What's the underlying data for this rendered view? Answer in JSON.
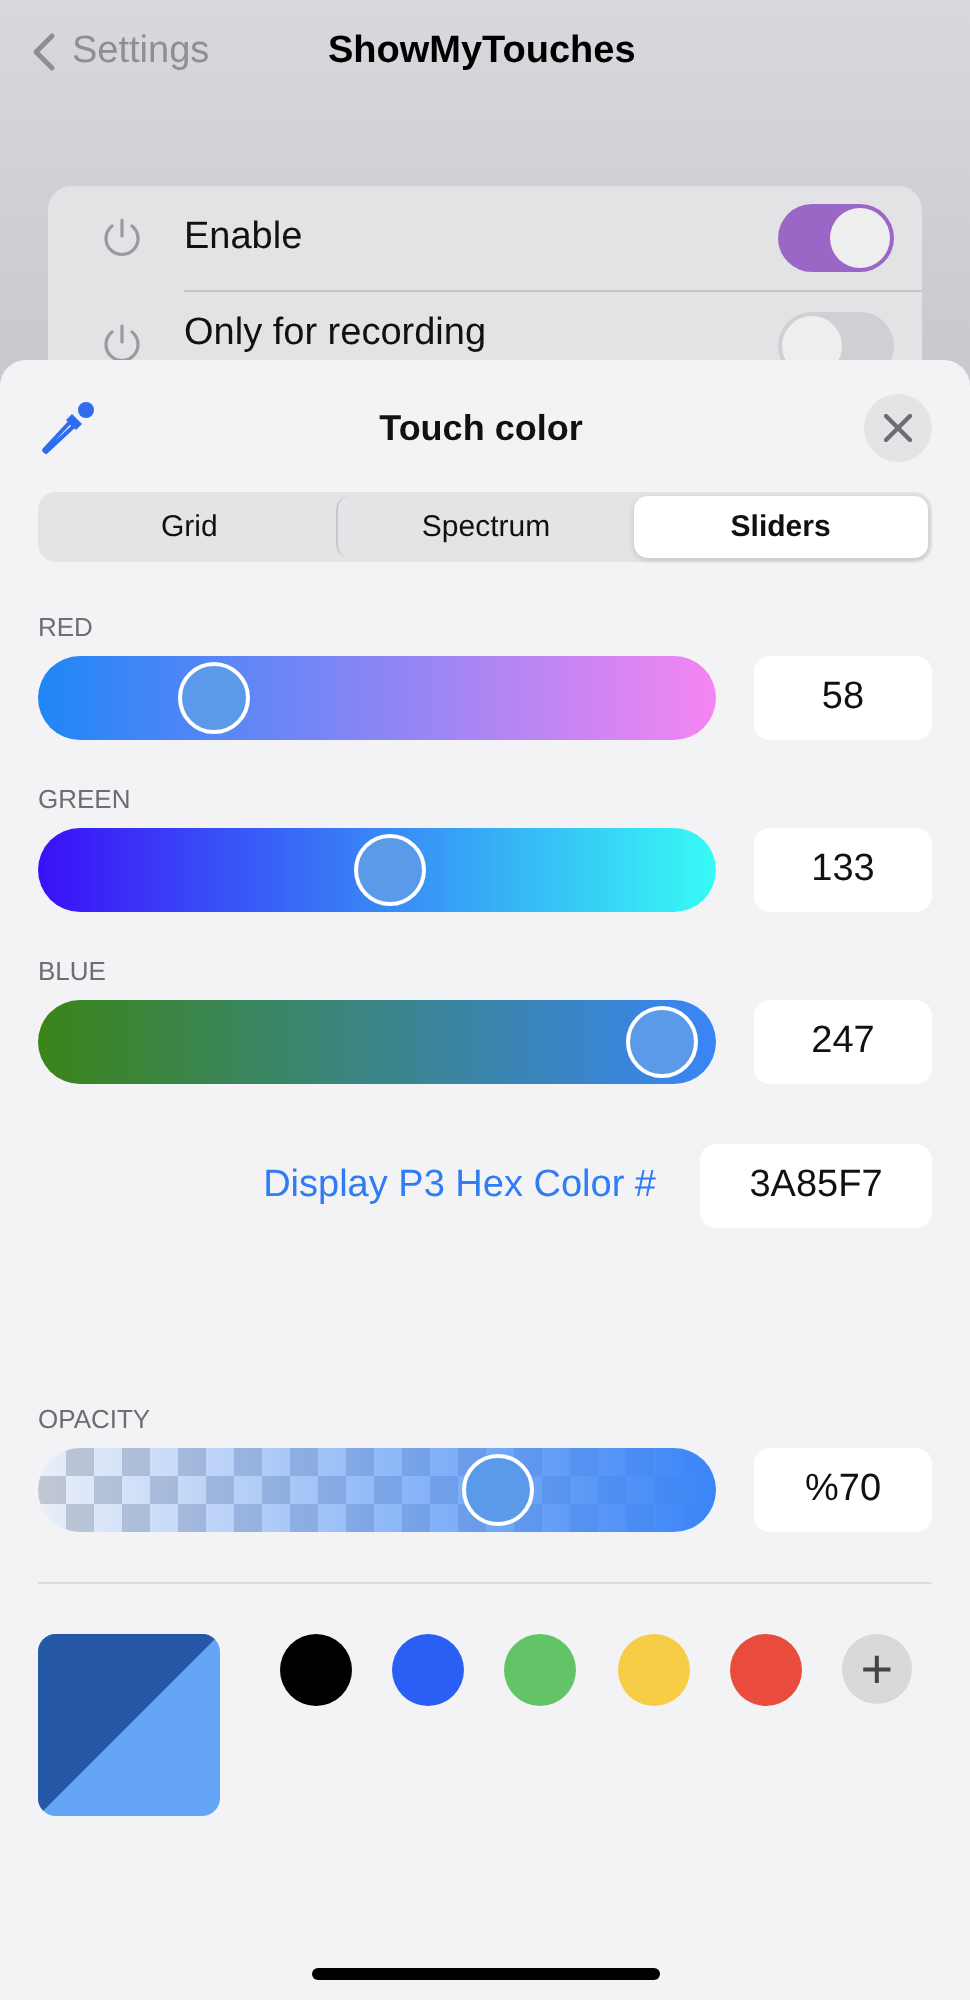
{
  "nav": {
    "back": "Settings",
    "title": "ShowMyTouches"
  },
  "settings": [
    {
      "label": "Enable",
      "on": true
    },
    {
      "label": "Only for recording",
      "on": false
    }
  ],
  "sheet": {
    "title": "Touch color",
    "tabs": [
      {
        "label": "Grid",
        "selected": false
      },
      {
        "label": "Spectrum",
        "selected": false
      },
      {
        "label": "Sliders",
        "selected": true
      }
    ],
    "sliders": [
      {
        "kind": "red",
        "label": "RED",
        "level": 0.23,
        "value": "58"
      },
      {
        "kind": "green",
        "label": "GREEN",
        "level": 0.52,
        "value": "133"
      },
      {
        "kind": "blue",
        "label": "BLUE",
        "level": 0.97,
        "value": "247"
      }
    ],
    "hex": {
      "label": "Display P3 Hex Color #",
      "value": "3A85F7"
    },
    "opacity": {
      "label": "OPACITY",
      "level": 0.7,
      "value": "%70"
    },
    "swatches": [
      {
        "color": "#000000"
      },
      {
        "color": "#2a5ff5"
      },
      {
        "color": "#62c466"
      },
      {
        "color": "#f7cd45"
      },
      {
        "color": "#e94b3d"
      }
    ],
    "add": "+"
  }
}
